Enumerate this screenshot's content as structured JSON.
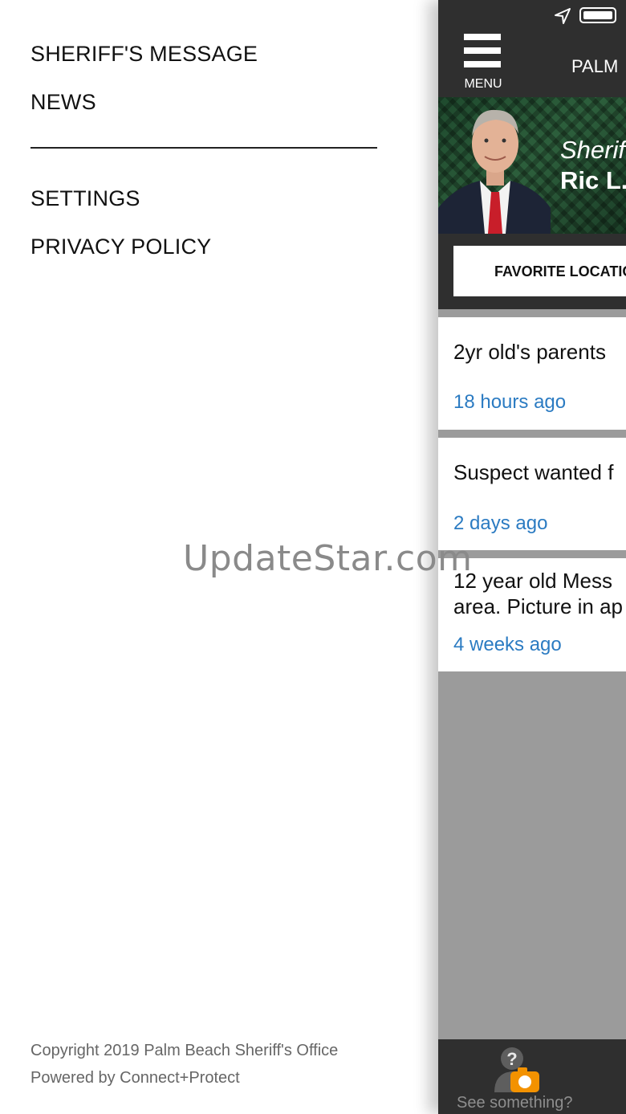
{
  "drawer": {
    "items": [
      {
        "label": "SHERIFF'S MESSAGE"
      },
      {
        "label": "NEWS"
      },
      {
        "label": "SETTINGS"
      },
      {
        "label": "PRIVACY POLICY"
      }
    ],
    "footer": {
      "copyright": "Copyright 2019 Palm Beach Sheriff's Office",
      "powered_by": "Powered by Connect+Protect"
    }
  },
  "watermark": "UpdateStar.com",
  "app": {
    "status_icons": [
      "location-arrow-icon",
      "battery-icon"
    ],
    "menu_label": "MENU",
    "title": "PALM",
    "banner": {
      "subtitle": "Sherif",
      "name": "Ric L."
    },
    "favorite_button": "FAVORITE LOCATIO",
    "news": [
      {
        "title": [
          "2yr old's parents"
        ],
        "time": "18 hours ago"
      },
      {
        "title": [
          "Suspect wanted f"
        ],
        "time": "2 days ago"
      },
      {
        "title": [
          "12 year old Mess",
          "area. Picture in ap"
        ],
        "time": "4 weeks ago"
      }
    ],
    "see_something": "See something?"
  },
  "colors": {
    "topbar": "#2f2f2f",
    "link_blue": "#2b7bc2",
    "panel_gray": "#9b9b9b",
    "camera_orange": "#f39200"
  }
}
